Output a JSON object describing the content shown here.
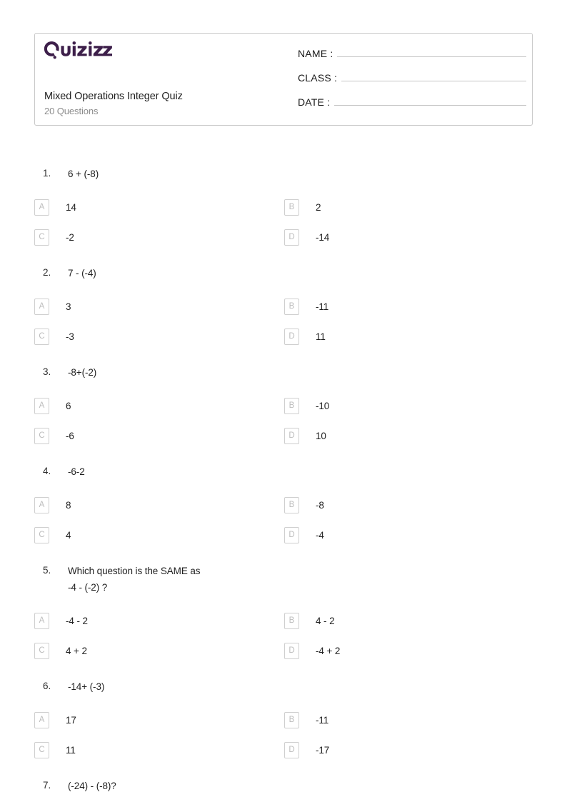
{
  "brand": {
    "name": "Quizizz",
    "color": "#3d1f4a"
  },
  "header": {
    "title": "Mixed Operations Integer Quiz",
    "subtitle": "20 Questions",
    "fields": [
      {
        "label": "NAME :",
        "value": ""
      },
      {
        "label": "CLASS :",
        "value": ""
      },
      {
        "label": "DATE  :",
        "value": ""
      }
    ]
  },
  "questions": [
    {
      "number": "1.",
      "text": "6 + (-8)",
      "options": [
        {
          "letter": "A",
          "text": "14"
        },
        {
          "letter": "B",
          "text": "2"
        },
        {
          "letter": "C",
          "text": "-2"
        },
        {
          "letter": "D",
          "text": "-14"
        }
      ]
    },
    {
      "number": "2.",
      "text": "7 - (-4)",
      "options": [
        {
          "letter": "A",
          "text": "3"
        },
        {
          "letter": "B",
          "text": "-11"
        },
        {
          "letter": "C",
          "text": "-3"
        },
        {
          "letter": "D",
          "text": "11"
        }
      ]
    },
    {
      "number": "3.",
      "text": "-8+(-2)",
      "options": [
        {
          "letter": "A",
          "text": "6"
        },
        {
          "letter": "B",
          "text": "-10"
        },
        {
          "letter": "C",
          "text": "-6"
        },
        {
          "letter": "D",
          "text": "10"
        }
      ]
    },
    {
      "number": "4.",
      "text": "-6-2",
      "options": [
        {
          "letter": "A",
          "text": "8"
        },
        {
          "letter": "B",
          "text": "-8"
        },
        {
          "letter": "C",
          "text": "4"
        },
        {
          "letter": "D",
          "text": "-4"
        }
      ]
    },
    {
      "number": "5.",
      "text": "Which question is the SAME as\n-4 - (-2)      ?",
      "options": [
        {
          "letter": "A",
          "text": "-4 - 2"
        },
        {
          "letter": "B",
          "text": "4 - 2"
        },
        {
          "letter": "C",
          "text": "4 + 2"
        },
        {
          "letter": "D",
          "text": "-4 + 2"
        }
      ]
    },
    {
      "number": "6.",
      "text": "-14+ (-3)",
      "options": [
        {
          "letter": "A",
          "text": "17"
        },
        {
          "letter": "B",
          "text": "-11"
        },
        {
          "letter": "C",
          "text": "11"
        },
        {
          "letter": "D",
          "text": "-17"
        }
      ]
    },
    {
      "number": "7.",
      "text": "(-24) - (-8)?",
      "options": []
    }
  ]
}
